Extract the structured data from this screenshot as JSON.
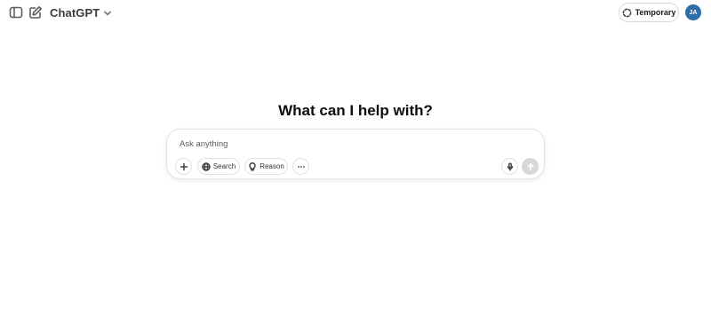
{
  "header": {
    "model_name": "ChatGPT",
    "temporary_label": "Temporary",
    "avatar_initials": "JA",
    "avatar_color": "#2f6fa8"
  },
  "icons": {
    "sidebar": "sidebar-toggle-icon",
    "new_chat": "new-chat-icon",
    "dropdown": "chevron-down-icon",
    "temporary": "dashed-circle-icon",
    "plus": "plus-icon",
    "search": "globe-icon",
    "reason": "lightbulb-icon",
    "more": "ellipsis-icon",
    "mic": "microphone-icon",
    "send": "arrow-up-icon"
  },
  "main": {
    "heading": "What can I help with?"
  },
  "composer": {
    "placeholder": "Ask anything",
    "value": "",
    "tools": {
      "search_label": "Search",
      "reason_label": "Reason"
    },
    "send_disabled_color": "#d7d7d7"
  }
}
